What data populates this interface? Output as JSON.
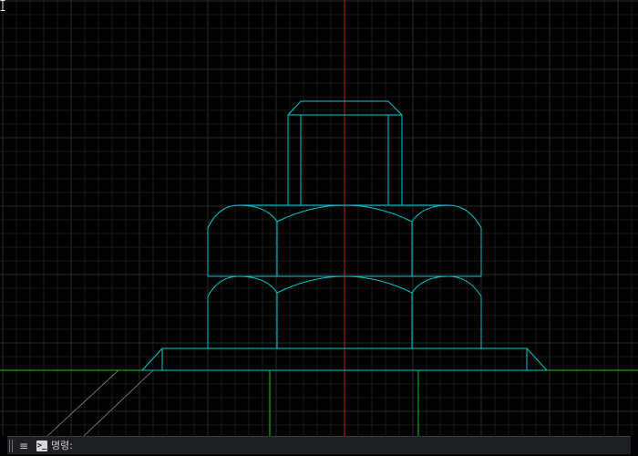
{
  "command_line": {
    "prompt_label": "명령:",
    "input_value": "",
    "input_placeholder": "",
    "prompt_icon_glyph": ">_",
    "menu_icon_glyph": "≡"
  },
  "icons": {
    "menu": "hamburger-menu-icon",
    "prompt": "command-prompt-icon",
    "cursor": "text-cursor-icon"
  },
  "colors": {
    "background": "#000000",
    "grid_minor": "#1a1a1a",
    "grid_major": "#2a2a2a",
    "model_lines": "#00c8d2",
    "y_axis": "#c81e1e",
    "x_axis": "#1ec81e",
    "ground_edges": "#1ec81e",
    "construction_lines": "#8a8a8a"
  }
}
